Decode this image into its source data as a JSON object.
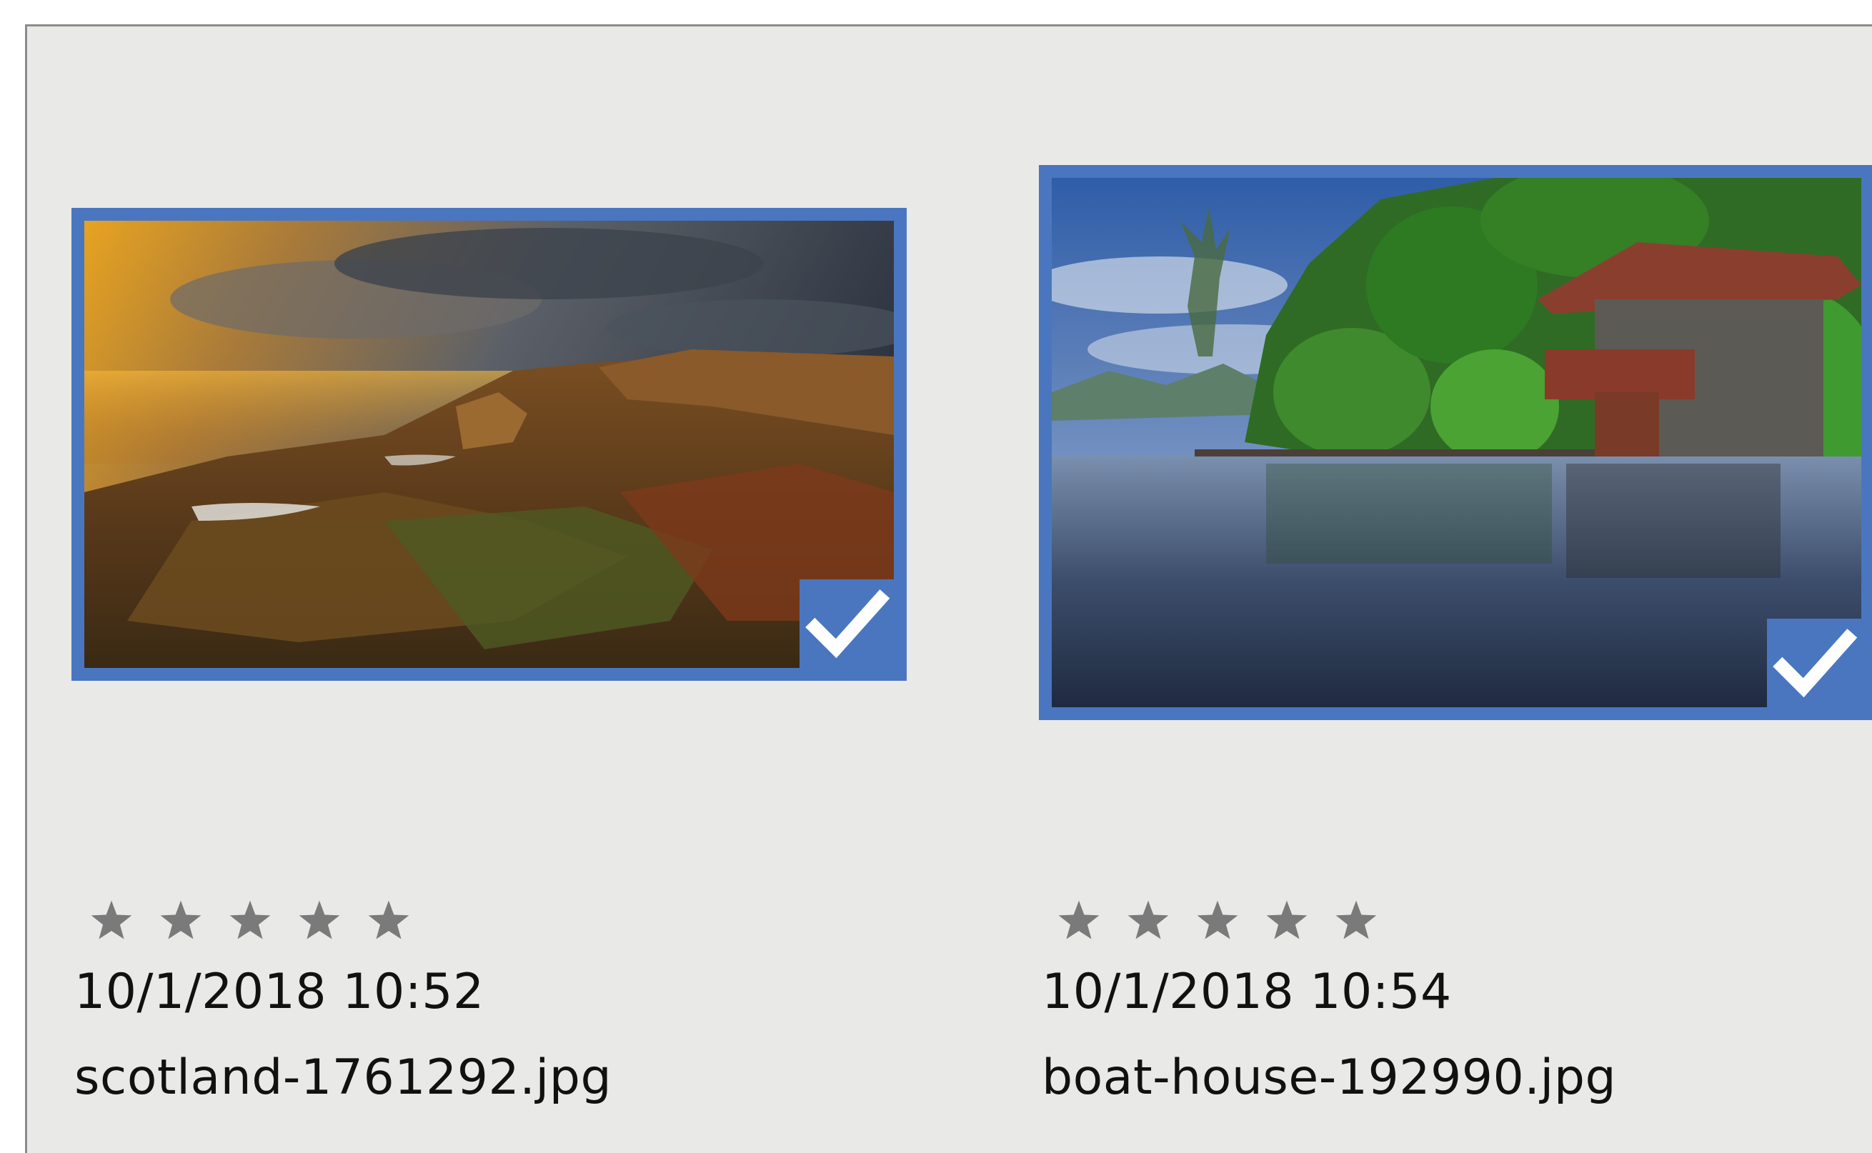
{
  "items": [
    {
      "date": "10/1/2018 10:52",
      "filename": "scotland-1761292.jpg",
      "selected": true,
      "rating": 0,
      "image": "mountain-landscape-sunset"
    },
    {
      "date": "10/1/2018 10:54",
      "filename": "boat-house-192990.jpg",
      "selected": true,
      "rating": 0,
      "image": "boat-house-on-lake"
    }
  ],
  "colors": {
    "selection": "#4a76c0",
    "panel": "#e9e9e7",
    "star": "#7a7a7a"
  },
  "icons": [
    "checkmark-icon",
    "star-icon"
  ]
}
